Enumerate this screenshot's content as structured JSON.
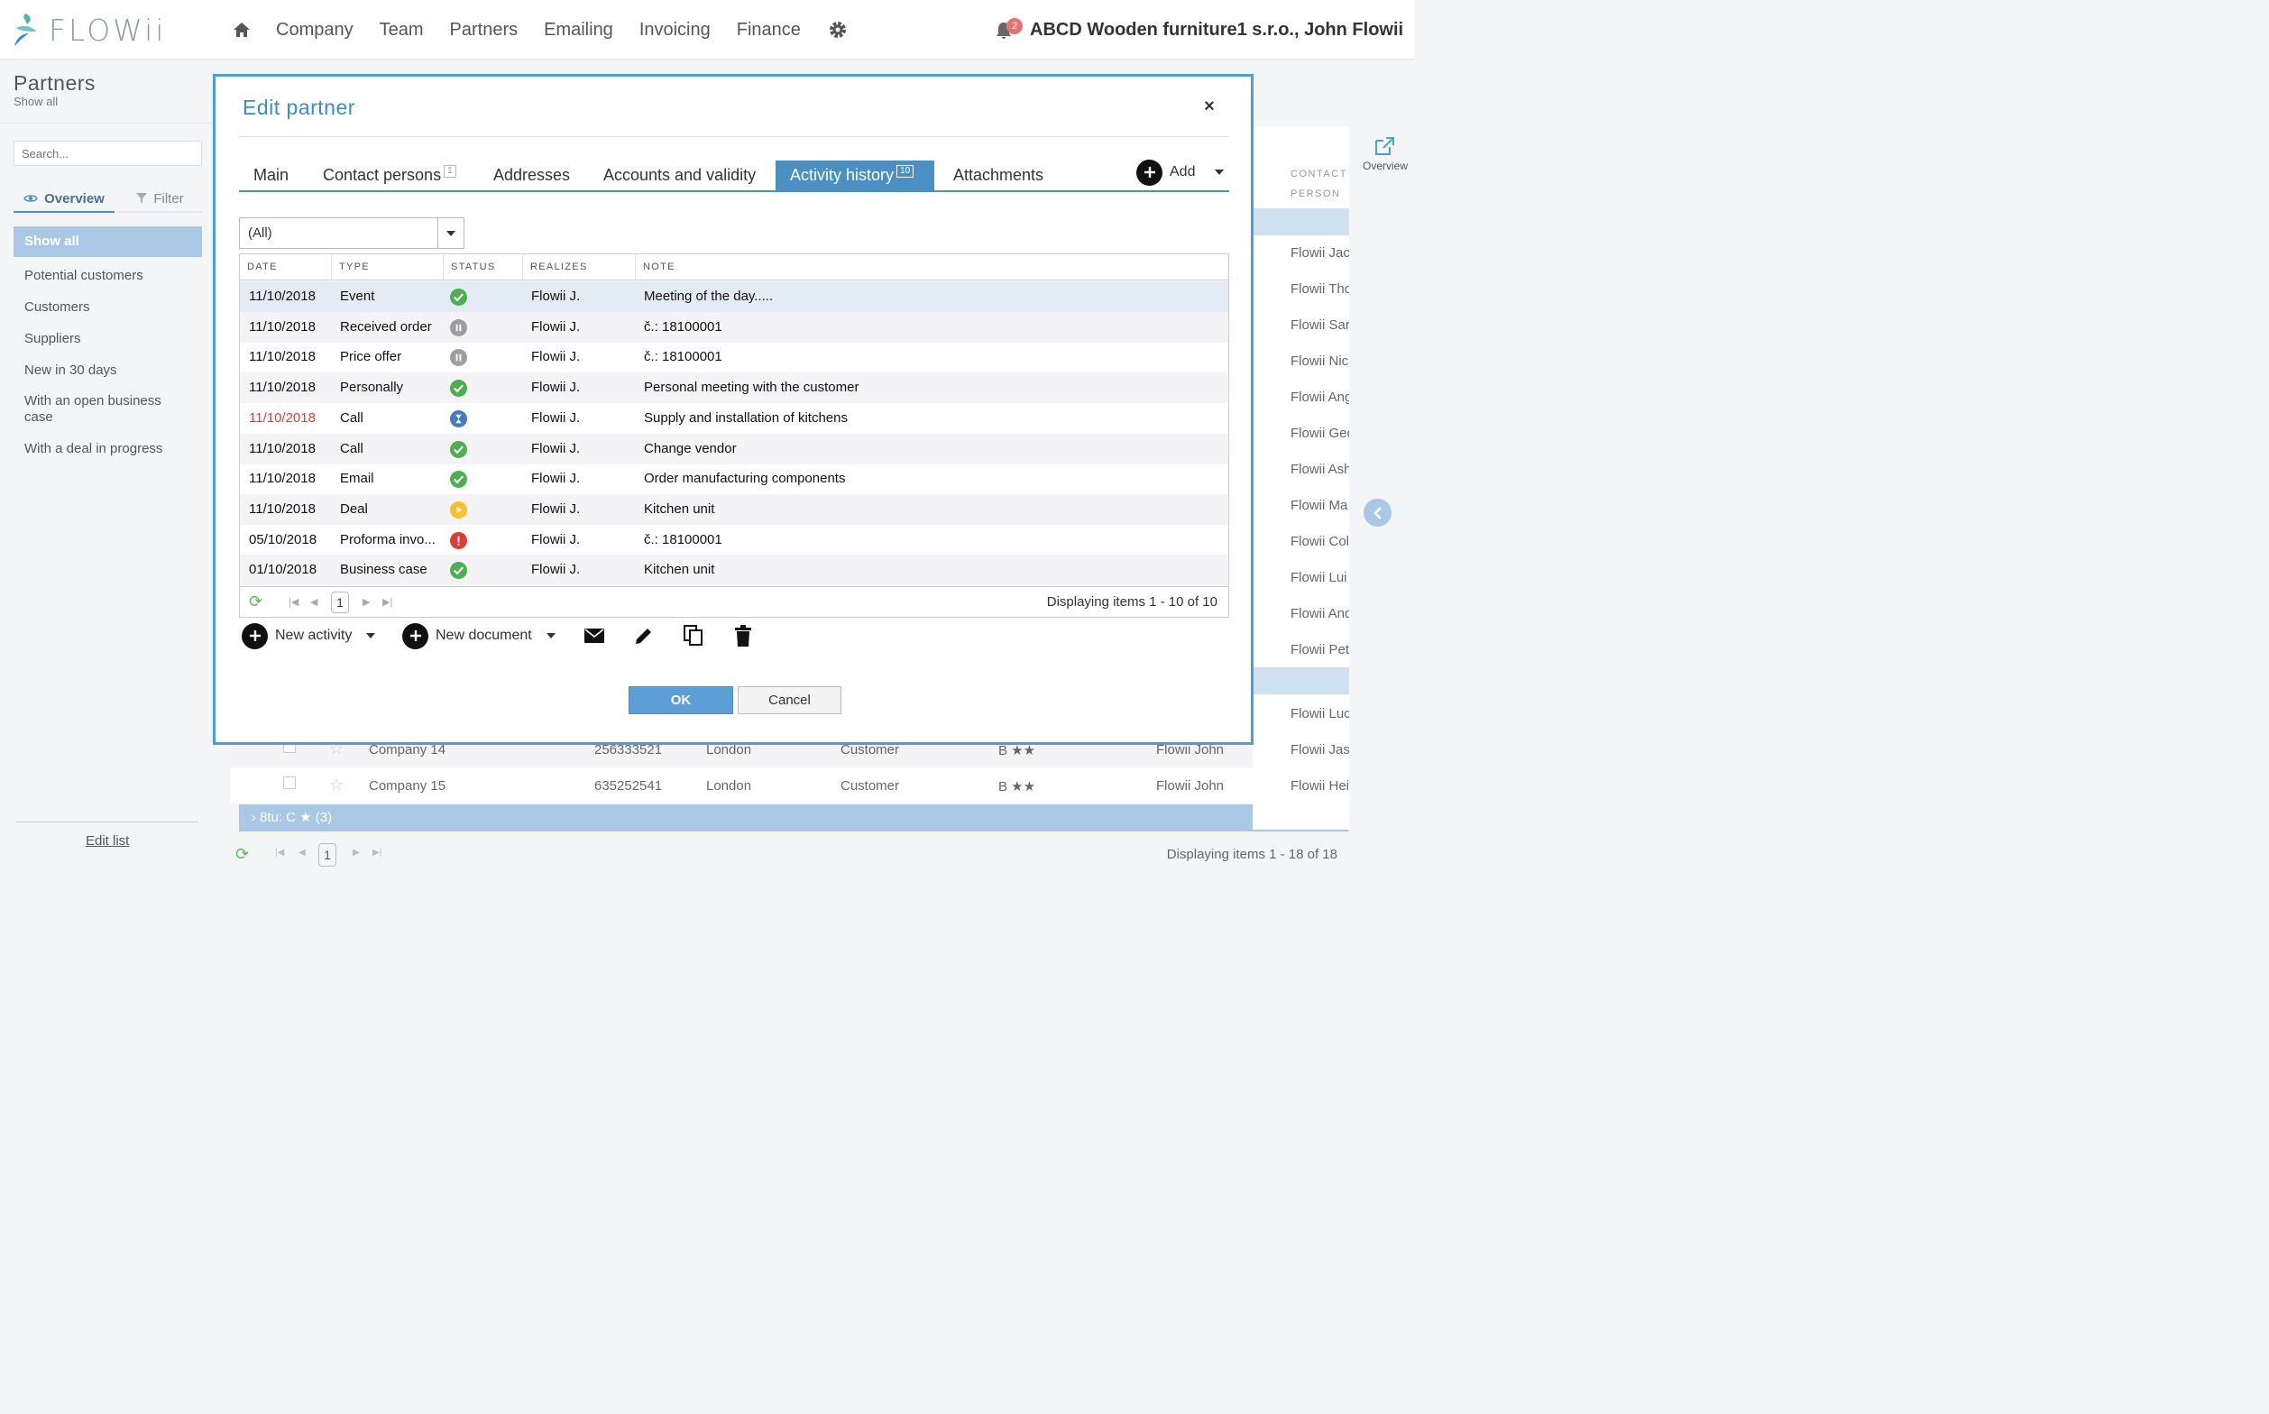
{
  "brand": {
    "logo_text": "FLOWii"
  },
  "topnav": {
    "items": [
      "Company",
      "Team",
      "Partners",
      "Emailing",
      "Invoicing",
      "Finance"
    ],
    "notification_count": "2",
    "user": "ABCD Wooden furniture1 s.r.o., John Flowii"
  },
  "sidebar": {
    "title": "Partners",
    "subtitle": "Show all",
    "search_placeholder": "Search...",
    "tab_overview": "Overview",
    "tab_filter": "Filter",
    "items": [
      "Show all",
      "Potential customers",
      "Customers",
      "Suppliers",
      "New in 30 days",
      "With an open business case",
      "With a deal in progress"
    ],
    "edit_list": "Edit list"
  },
  "background": {
    "right_header": "CONTACT PERSON",
    "overview_label": "Overview",
    "contact_names": [
      "Flowii Jac",
      "Flowii Tho",
      "Flowii Sar",
      "Flowii Nic",
      "Flowii Ang",
      "Flowii Geo",
      "Flowii Ash",
      "Flowii Ma",
      "Flowii Col",
      "Flowii Lui",
      "Flowii And",
      "Flowii Pet",
      "Flowii Luc",
      "Flowii Jas",
      "Flowii Hei"
    ],
    "rows": [
      {
        "company": "Company 14",
        "id": "256333521",
        "city": "London",
        "type": "Customer",
        "rating": "B ★★",
        "owner": "Flowii John"
      },
      {
        "company": "Company 15",
        "id": "635252541",
        "city": "London",
        "type": "Customer",
        "rating": "B ★★",
        "owner": "Flowii John"
      }
    ],
    "group_label": "8tu: C ★ (3)",
    "pager_page": "1",
    "pager_info": "Displaying items 1 - 18 of 18"
  },
  "modal": {
    "title": "Edit partner",
    "close": "×",
    "tabs": [
      {
        "label": "Main",
        "badge": ""
      },
      {
        "label": "Contact persons",
        "badge": "1"
      },
      {
        "label": "Addresses",
        "badge": ""
      },
      {
        "label": "Accounts and validity",
        "badge": ""
      },
      {
        "label": "Activity history",
        "badge": "10"
      },
      {
        "label": "Attachments",
        "badge": ""
      }
    ],
    "active_tab": "Activity history",
    "add_label": "Add",
    "filter_value": "(All)",
    "columns": [
      "DATE",
      "TYPE",
      "STATUS",
      "REALIZES",
      "NOTE"
    ],
    "rows": [
      {
        "date": "11/10/2018",
        "type": "Event",
        "status": "done",
        "realizes": "Flowii J.",
        "note": "Meeting of the day.....",
        "overdue": false
      },
      {
        "date": "11/10/2018",
        "type": "Received order",
        "status": "paused",
        "realizes": "Flowii J.",
        "note": "č.: 18100001",
        "overdue": false
      },
      {
        "date": "11/10/2018",
        "type": "Price offer",
        "status": "paused",
        "realizes": "Flowii J.",
        "note": "č.: 18100001",
        "overdue": false
      },
      {
        "date": "11/10/2018",
        "type": "Personally",
        "status": "done",
        "realizes": "Flowii J.",
        "note": "Personal meeting with the customer",
        "overdue": false
      },
      {
        "date": "11/10/2018",
        "type": "Call",
        "status": "waiting",
        "realizes": "Flowii J.",
        "note": "Supply and installation of kitchens",
        "overdue": true
      },
      {
        "date": "11/10/2018",
        "type": "Call",
        "status": "done",
        "realizes": "Flowii J.",
        "note": "Change vendor",
        "overdue": false
      },
      {
        "date": "11/10/2018",
        "type": "Email",
        "status": "done",
        "realizes": "Flowii J.",
        "note": "Order manufacturing components",
        "overdue": false
      },
      {
        "date": "11/10/2018",
        "type": "Deal",
        "status": "in-progress",
        "realizes": "Flowii J.",
        "note": "Kitchen unit",
        "overdue": false
      },
      {
        "date": "05/10/2018",
        "type": "Proforma invo...",
        "status": "error",
        "realizes": "Flowii J.",
        "note": "č.: 18100001",
        "overdue": false
      },
      {
        "date": "01/10/2018",
        "type": "Business case",
        "status": "done",
        "realizes": "Flowii J.",
        "note": "Kitchen unit",
        "overdue": false
      }
    ],
    "status_colors": {
      "done": "#4caf50",
      "paused": "#9e9e9e",
      "waiting": "#3f7fc1",
      "in-progress": "#f9c02b",
      "error": "#e53935"
    },
    "pager_page": "1",
    "pager_info": "Displaying items 1 - 10 of 10",
    "new_activity": "New activity",
    "new_document": "New document",
    "ok": "OK",
    "cancel": "Cancel"
  }
}
